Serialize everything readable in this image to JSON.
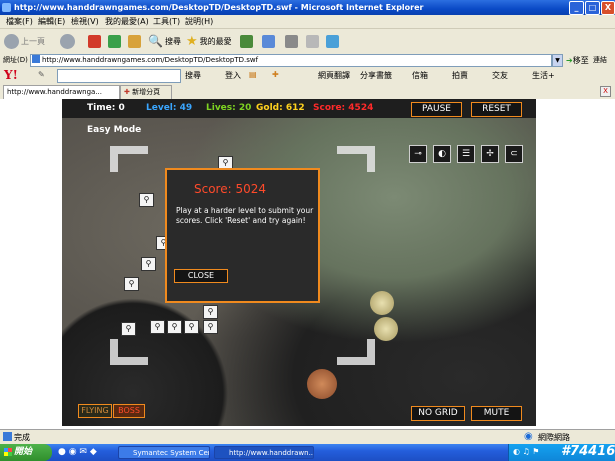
{
  "window": {
    "title": "http://www.handdrawngames.com/DesktopTD/DesktopTD.swf - Microsoft Internet Explorer",
    "min_label": "_",
    "max_label": "□",
    "close_label": "X"
  },
  "menu": {
    "items": [
      "檔案(F)",
      "編輯(E)",
      "檢視(V)",
      "我的最愛(A)",
      "工具(T)",
      "說明(H)"
    ]
  },
  "toolbar": {
    "back_label": "上一頁",
    "search_label": "搜尋",
    "favorites_label": "我的最愛"
  },
  "address": {
    "label": "網址(D)",
    "url": "http://www.handdrawngames.com/DesktopTD/DesktopTD.swf",
    "go_label": "移至",
    "links_label": "連結"
  },
  "yahoo_toolbar": {
    "logo": "Y!",
    "search_label": "搜尋",
    "signin_label": "登入",
    "translate_label": "網頁翻譯",
    "share_label": "分享書籤",
    "mail_label": "信箱",
    "auction_label": "拍賣",
    "friends_label": "交友",
    "life_label": "生活+"
  },
  "tabs": {
    "active": "http://www.handdrawnga...",
    "new_tab": "新增分頁",
    "close_label": "X"
  },
  "game": {
    "hud": {
      "time_label": "Time:",
      "time_value": "0",
      "level_label": "Level:",
      "level_value": "49",
      "lives_label": "Lives:",
      "lives_value": "20",
      "gold_label": "Gold:",
      "gold_value": "612",
      "score_label": "Score:",
      "score_value": "4524"
    },
    "pause_label": "PAUSE",
    "reset_label": "RESET",
    "mode_label": "Easy Mode",
    "dialog": {
      "title": "Score: 5024",
      "message": "Play at a harder level to submit your scores. Click 'Reset' and try again!",
      "close_label": "CLOSE"
    },
    "flying_label": "FLYING",
    "boss_label": "BOSS",
    "nogrid_label": "NO GRID",
    "mute_label": "MUTE",
    "colors": {
      "accent": "#f08a1e",
      "time": "#ffffff",
      "level": "#3aa6ff",
      "lives": "#7ed321",
      "gold": "#ffd21e",
      "score": "#ff2a2a"
    }
  },
  "status": {
    "text": "完成",
    "zone": "網際網路"
  },
  "taskbar": {
    "start_label": "開始",
    "tasks": [
      "Symantec System Cent...",
      "http://www.handdrawn..."
    ],
    "watermark": "#74416"
  }
}
